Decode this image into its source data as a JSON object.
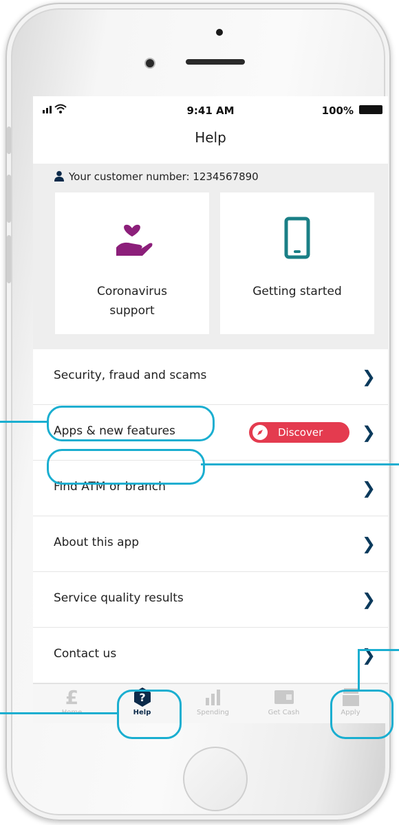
{
  "status_bar": {
    "time": "9:41 AM",
    "battery": "100%"
  },
  "header": {
    "title": "Help"
  },
  "customer": {
    "label": "Your customer number: 1234567890"
  },
  "tiles": [
    {
      "label_line1": "Coronavirus",
      "label_line2": "support",
      "icon": "heart-hand-icon"
    },
    {
      "label_line1": "Getting started",
      "label_line2": "",
      "icon": "phone-icon"
    }
  ],
  "menu": [
    {
      "label": "Security, fraud and scams"
    },
    {
      "label": "Apps & new features",
      "badge": "Discover"
    },
    {
      "label": "Find ATM or branch"
    },
    {
      "label": "About this app"
    },
    {
      "label": "Service quality results"
    },
    {
      "label": "Contact us"
    }
  ],
  "tabs": [
    {
      "label": "Home",
      "icon": "pound-icon"
    },
    {
      "label": "Help",
      "icon": "question-shield-icon",
      "active": true
    },
    {
      "label": "Spending",
      "icon": "bar-chart-icon"
    },
    {
      "label": "Get Cash",
      "icon": "cash-icon"
    },
    {
      "label": "Apply",
      "icon": "inbox-icon"
    }
  ],
  "colors": {
    "accent": "#1aaed0",
    "brand_navy": "#0b2a4a",
    "badge_red": "#e43b4f",
    "coronavirus_purple": "#8c1f7a",
    "getting_started_teal": "#1a7f86"
  }
}
